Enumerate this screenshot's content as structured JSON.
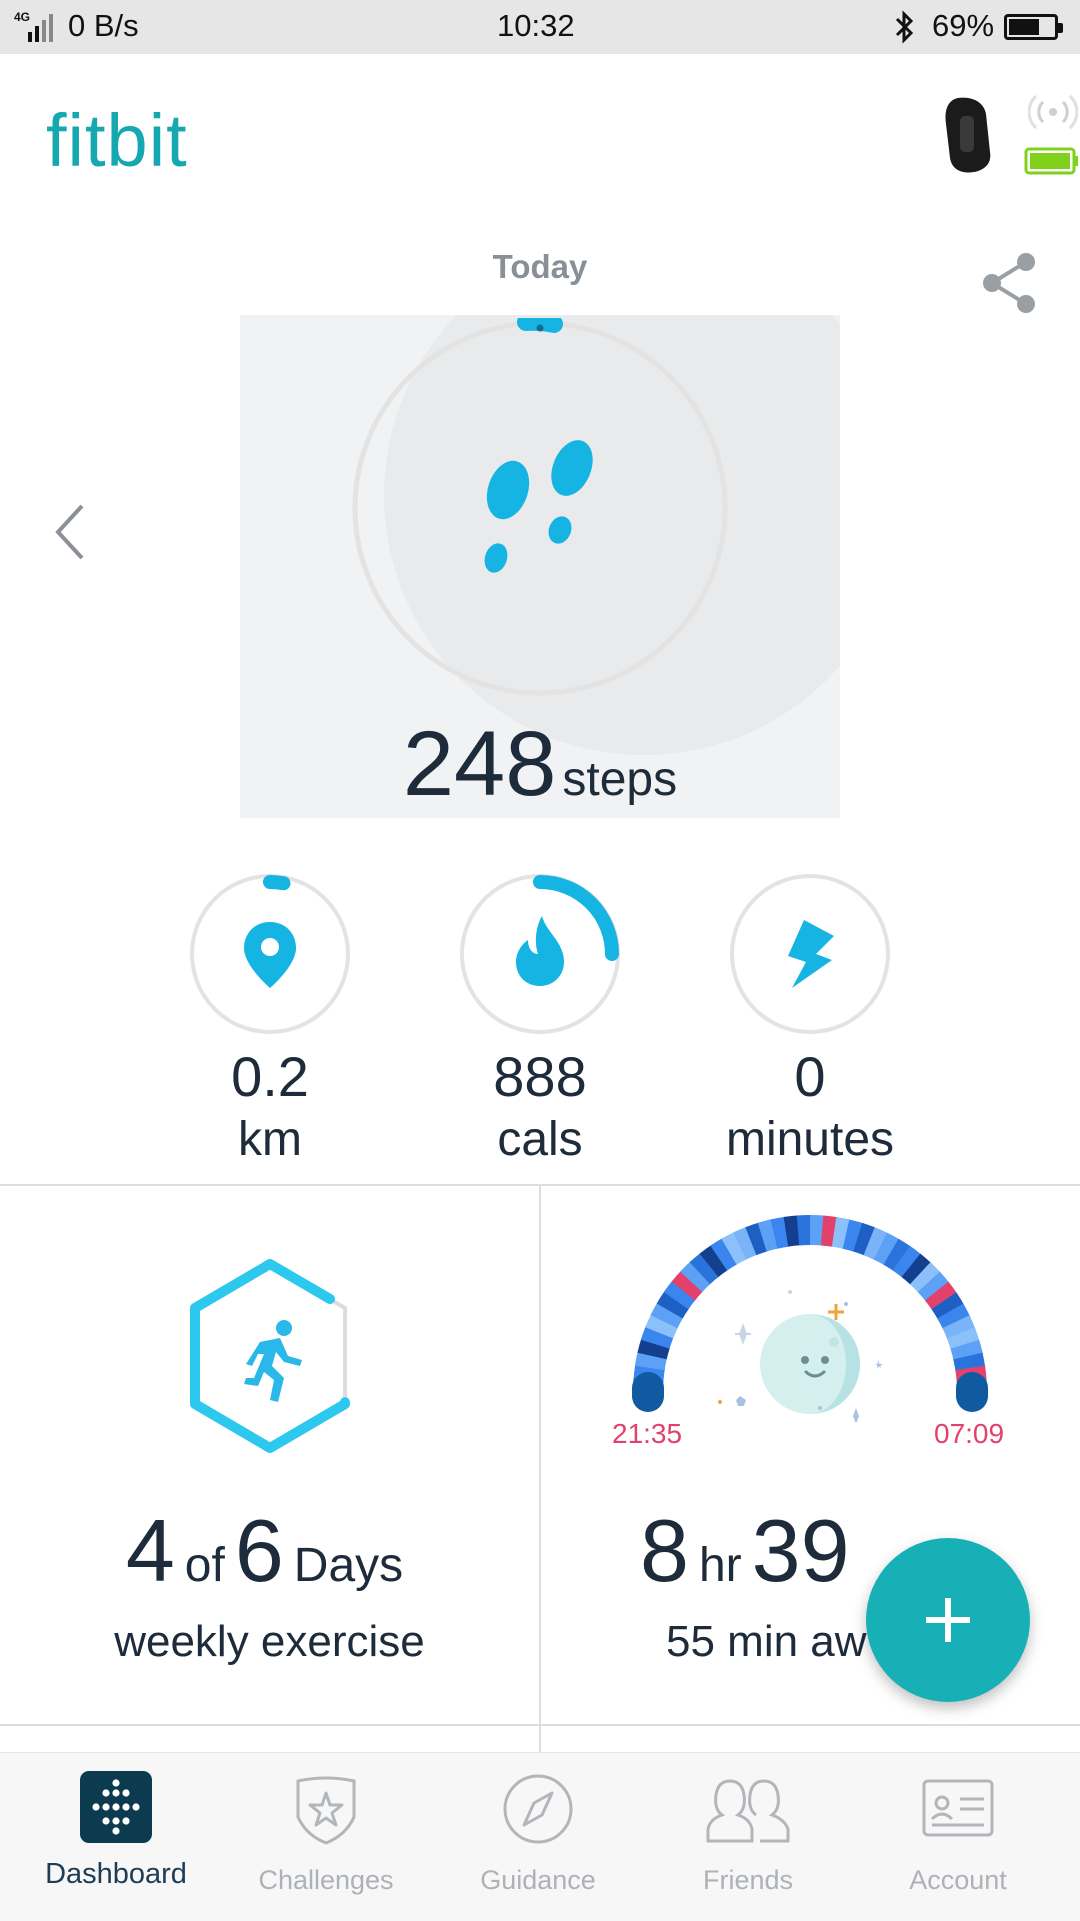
{
  "status_bar": {
    "network": "4G",
    "speed": "0 B/s",
    "time": "10:32",
    "battery": "69%",
    "battery_level": 0.69
  },
  "header": {
    "logo": "fitbit"
  },
  "today": {
    "label": "Today",
    "steps_value": "248",
    "steps_unit": "steps"
  },
  "stats": [
    {
      "value": "0.2",
      "unit": "km",
      "icon": "location-pin-icon",
      "progress": 0.02
    },
    {
      "value": "888",
      "unit": "cals",
      "icon": "flame-icon",
      "progress": 0.25
    },
    {
      "value": "0",
      "unit": "minutes",
      "icon": "lightning-icon",
      "progress": 0
    }
  ],
  "exercise": {
    "value": "4",
    "of": "of",
    "goal": "6",
    "unit": "Days",
    "subtitle": "weekly exercise",
    "progress": 0.67
  },
  "sleep": {
    "start": "21:35",
    "end": "07:09",
    "hours": "8",
    "hours_unit": "hr",
    "minutes": "39",
    "subtitle": "55 min aw"
  },
  "nav": [
    {
      "label": "Dashboard",
      "icon": "dashboard-icon",
      "active": true
    },
    {
      "label": "Challenges",
      "icon": "challenges-badge-icon",
      "active": false
    },
    {
      "label": "Guidance",
      "icon": "compass-icon",
      "active": false
    },
    {
      "label": "Friends",
      "icon": "friends-icon",
      "active": false
    },
    {
      "label": "Account",
      "icon": "account-card-icon",
      "active": false
    }
  ],
  "colors": {
    "brand": "#16a8b1",
    "accent": "#12b4e3",
    "fab": "#16b0b6",
    "sleep_time": "#e2416c",
    "text": "#1d2b3a"
  }
}
